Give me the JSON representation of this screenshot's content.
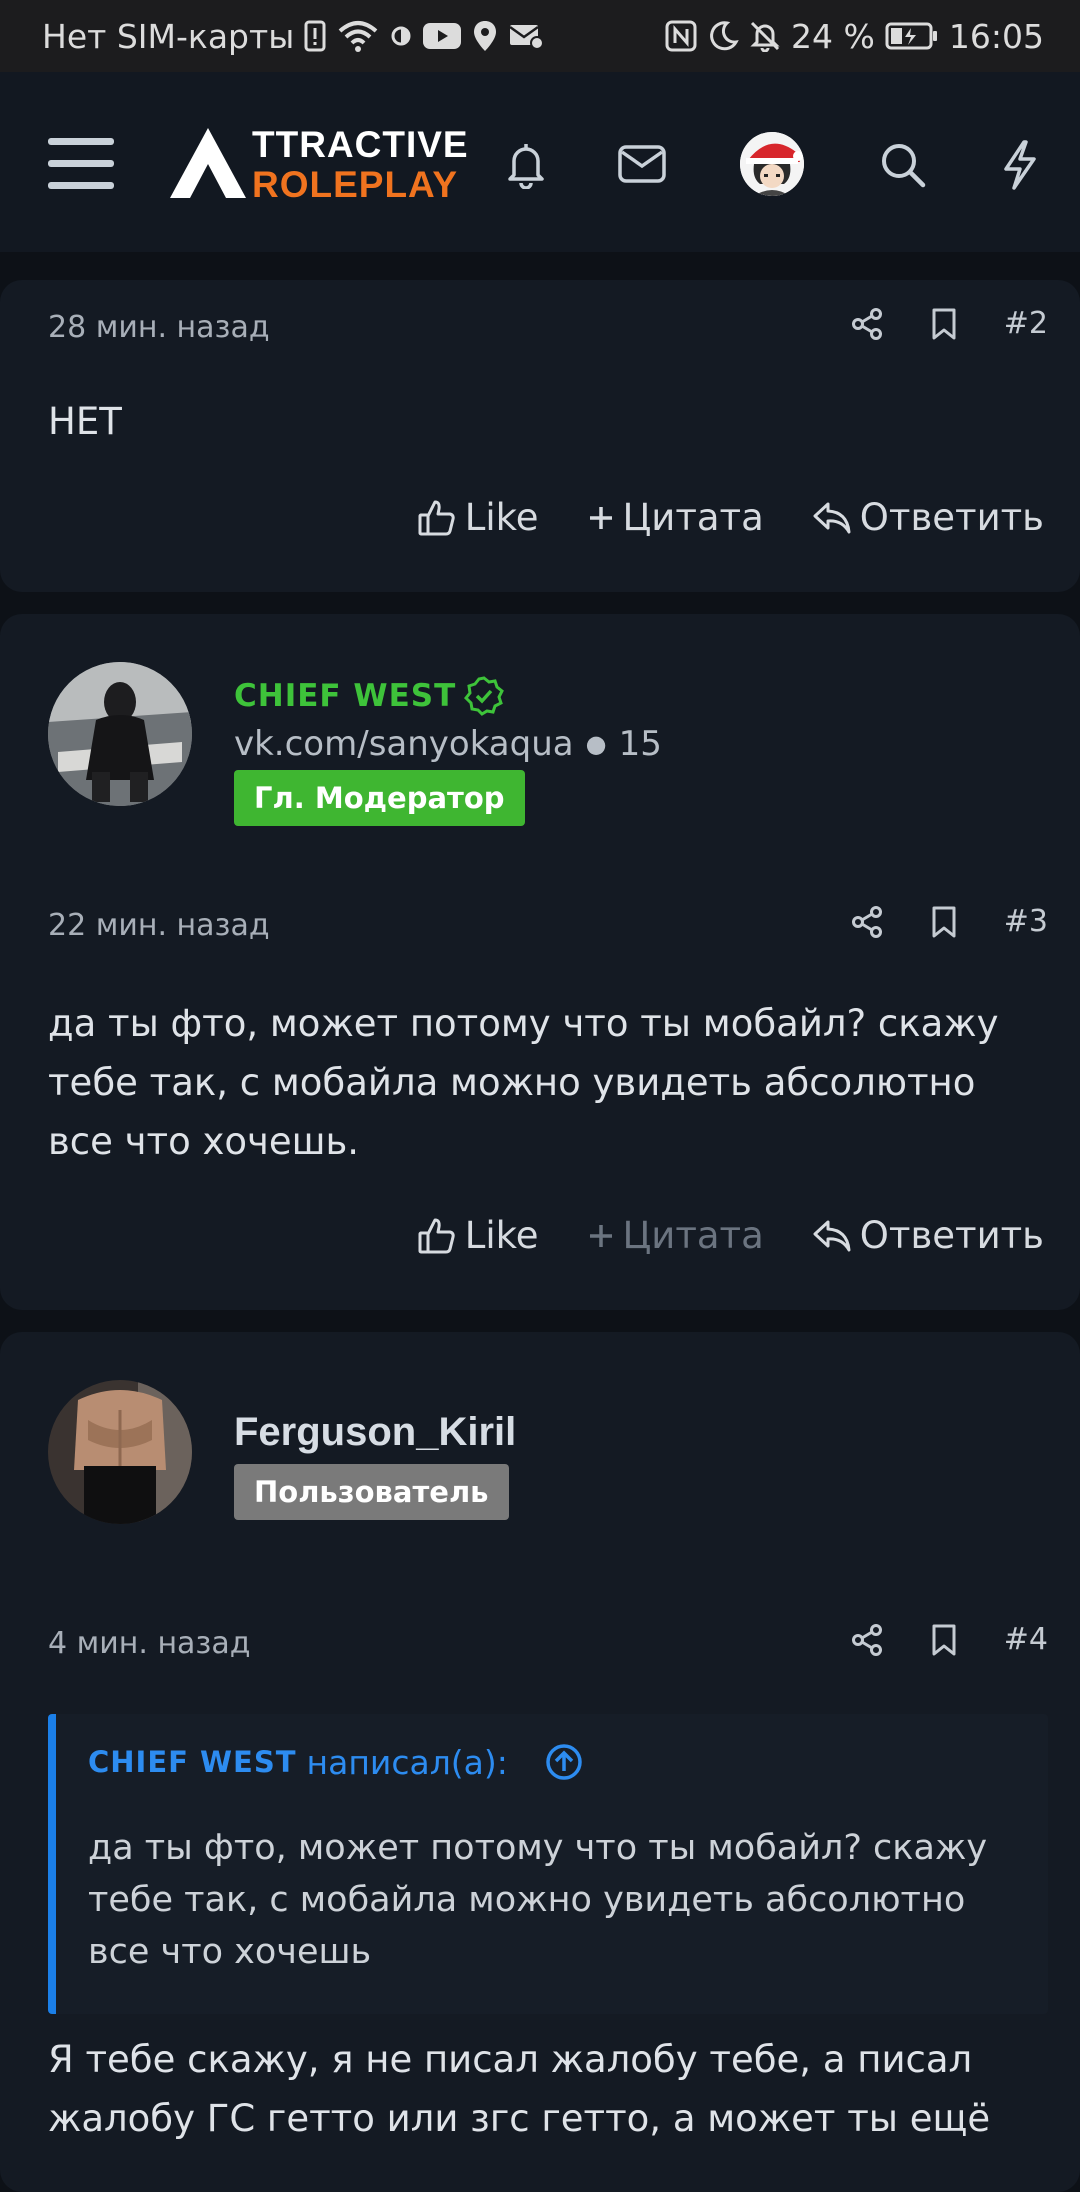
{
  "statusbar": {
    "carrier": "Нет SIM-карты",
    "battery": "24 %",
    "time": "16:05"
  },
  "header": {
    "logo_top": "TTRACTIVE",
    "logo_bottom": "ROLEPLAY",
    "brand_color": "#f0731f"
  },
  "posts": [
    {
      "time": "28 мин. назад",
      "number": "#2",
      "text": "НЕТ",
      "like": "Like",
      "quote": "Цитата",
      "reply": "Ответить"
    },
    {
      "author": "CHIEF WEST",
      "author_color": "#3ec33a",
      "subtitle": "vk.com/sanyokaqua",
      "count": "15",
      "role": "Гл. Модератор",
      "role_color": "#3fb631",
      "time": "22 мин. назад",
      "number": "#3",
      "text": "да ты фто, может потому что ты мобайл? скажу тебе так, с мобайла можно увидеть абсолютно все что хочешь.",
      "like": "Like",
      "quote": "Цитата",
      "reply": "Ответить"
    },
    {
      "author": "Ferguson_Kiril",
      "role": "Пользователь",
      "role_color": "#7a7a7a",
      "time": "4 мин. назад",
      "number": "#4",
      "quote_author": "CHIEF WEST",
      "quote_suffix": "написал(а):",
      "quote_text": "да ты фто, может потому что ты мобайл? скажу тебе так, с мобайла можно увидеть абсолютно все что хочешь",
      "text": "Я тебе скажу, я не писал жалобу тебе, а писал жалобу ГС гетто или згс гетто, а может ты ещё"
    }
  ]
}
